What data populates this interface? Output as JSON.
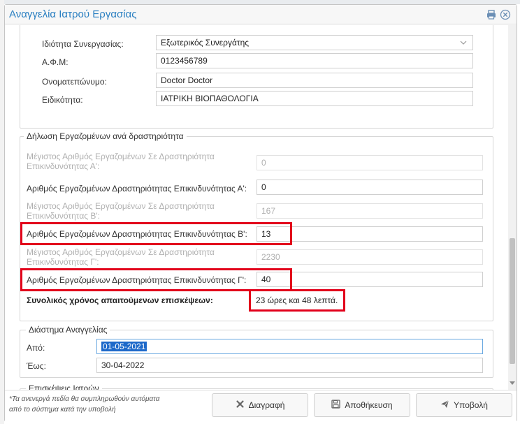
{
  "dialog": {
    "title": "Αναγγελία Ιατρού Εργασίας"
  },
  "doctor": {
    "cooperation_label": "Ιδιότητα Συνεργασίας:",
    "cooperation_value": "Εξωτερικός Συνεργάτης",
    "afm_label": "Α.Φ.Μ:",
    "afm_value": "0123456789",
    "name_label": "Ονοματεπώνυμο:",
    "name_value": "Doctor Doctor",
    "specialty_label": "Ειδικότητα:",
    "specialty_value": "ΙΑΤΡΙΚΗ ΒΙΟΠΑΘΟΛΟΓΙΑ"
  },
  "employees": {
    "legend": "Δήλωση Εργαζομένων ανά δραστηριότητα",
    "max_a_label_1": "Μέγιστος Αριθμός Εργαζομένων Σε Δραστηριότητα",
    "max_a_label_2": "Επικινδυνότητας Α':",
    "max_a_value": "0",
    "count_a_label": "Αριθμός Εργαζομένων Δραστηριότητας Επικινδυνότητας Α':",
    "count_a_value": "0",
    "max_b_label_1": "Μέγιστος Αριθμός Εργαζομένων Σε Δραστηριότητα",
    "max_b_label_2": "Επικινδυνότητας Β':",
    "max_b_value": "167",
    "count_b_label": "Αριθμός Εργαζομένων Δραστηριότητας Επικινδυνότητας Β':",
    "count_b_value": "13",
    "max_c_label_1": "Μέγιστος Αριθμός Εργαζομένων Σε Δραστηριότητα",
    "max_c_label_2": "Επικινδυνότητας Γ':",
    "max_c_value": "2230",
    "count_c_label": "Αριθμός Εργαζομένων Δραστηριότητας Επικινδυνότητας Γ':",
    "count_c_value": "40",
    "total_label": "Συνολικός χρόνος απαιτούμενων επισκέψεων:",
    "total_value": "23 ώρες και 48 λεπτά."
  },
  "period": {
    "legend": "Διάστημα Αναγγελίας",
    "from_label": "Από:",
    "from_value": "01-05-2021",
    "to_label": "Έως:",
    "to_value": "30-04-2022"
  },
  "visits": {
    "legend": "Επισκέψεις Ιατρών"
  },
  "footer": {
    "note_1": "*Τα ανενεργά πεδία θα συμπληρωθούν αυτόματα",
    "note_2": "από το σύστημα κατά την υποβολή",
    "delete_label": "Διαγραφή",
    "save_label": "Αποθήκευση",
    "submit_label": "Υποβολή"
  },
  "colors": {
    "accent": "#2a7fc1",
    "highlight": "#e2001a"
  },
  "icons": {
    "print": "print-icon",
    "close": "close-icon",
    "delete": "x-icon",
    "save": "floppy-icon",
    "submit": "paper-plane-icon"
  }
}
